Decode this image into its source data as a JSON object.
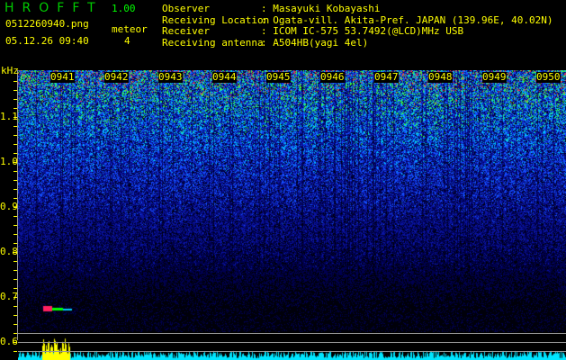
{
  "header": {
    "logo": "HROFFT",
    "version": "1.00",
    "filename": "0512260940.png",
    "datetime": "05.12.26 09:40",
    "meteor_label": "meteor",
    "meteor_count": "4"
  },
  "info": [
    {
      "label": "Observer",
      "value": ": Masayuki Kobayashi"
    },
    {
      "label": "Receiving Location",
      "value": ": Ogata-vill. Akita-Pref. JAPAN (139.96E, 40.02N)"
    },
    {
      "label": "Receiver",
      "value": ": ICOM IC-575 53.7492(@LCD)MHz USB"
    },
    {
      "label": "Receiving antenna",
      "value": ": A504HB(yagi 4el)"
    }
  ],
  "y_axis": {
    "unit": "kHz",
    "labels": [
      "1.1",
      "1.0",
      "0.9",
      "0.8",
      "0.7",
      "0.6"
    ]
  },
  "time_labels": [
    "0941",
    "0942",
    "0943",
    "0944",
    "0945",
    "0946",
    "0947",
    "0948",
    "0949",
    "0950"
  ],
  "colors": {
    "text": "#ffff00",
    "logo": "#00cc00",
    "baseline": "#00e5ff"
  }
}
